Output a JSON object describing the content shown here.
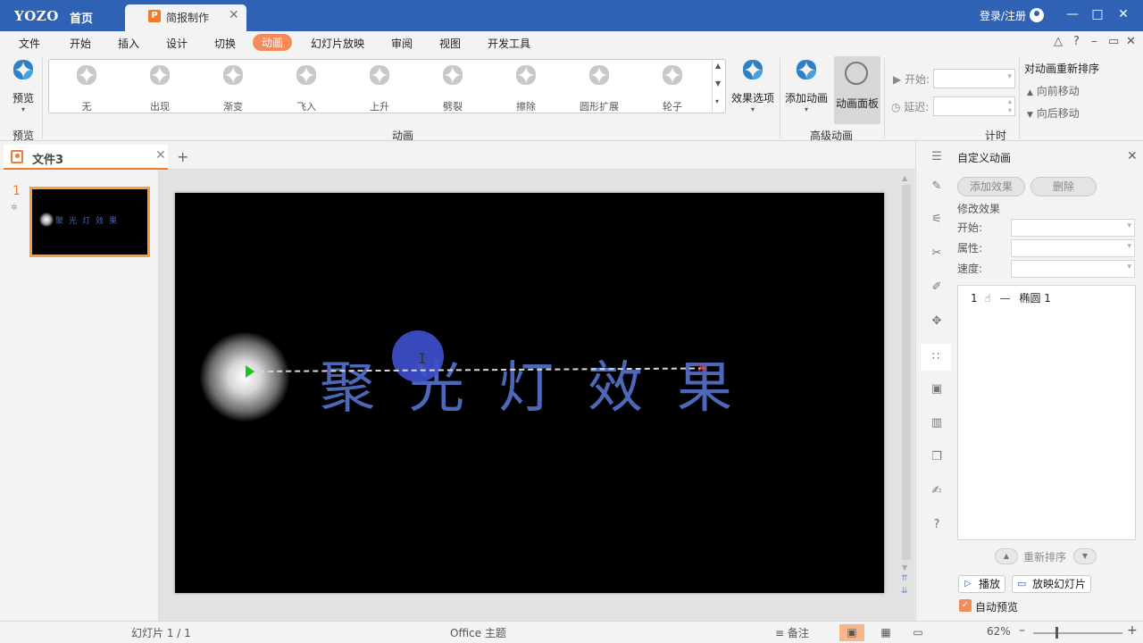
{
  "titlebar": {
    "logo": "YOZO",
    "home": "首页",
    "doc_tab": "简报制作",
    "login": "登录/注册",
    "minimize": "—",
    "maximize": "□",
    "close": "✕"
  },
  "menu": {
    "items": [
      "文件",
      "开始",
      "插入",
      "设计",
      "切换",
      "动画",
      "幻灯片放映",
      "审阅",
      "视图",
      "开发工具"
    ],
    "active": "动画"
  },
  "ribbon": {
    "preview_label": "预览",
    "preview_group": "预览",
    "gallery_items": [
      "无",
      "出现",
      "渐变",
      "飞入",
      "上升",
      "劈裂",
      "擦除",
      "圆形扩展",
      "轮子"
    ],
    "gallery_group": "动画",
    "effect_options": "效果选项",
    "add_animation": "添加动画",
    "animation_pane": "动画面板",
    "advanced_group": "高级动画",
    "start_label": "开始:",
    "delay_label": "延迟:",
    "timing_group": "计时",
    "reorder_title": "对动画重新排序",
    "move_earlier": "向前移动",
    "move_later": "向后移动"
  },
  "document": {
    "file_tab": "文件3",
    "slide_number": "1",
    "slide_title": "聚光灯效果"
  },
  "custom_animation": {
    "title": "自定义动画",
    "add_effect": "添加效果",
    "delete": "删除",
    "modify_label": "修改效果",
    "start_label": "开始:",
    "property_label": "属性:",
    "speed_label": "速度:",
    "list_item_index": "1",
    "list_item_name": "椭圆 1",
    "reorder_label": "重新排序",
    "play_button": "播放",
    "slideshow_button": "放映幻灯片",
    "auto_preview": "自动预览"
  },
  "statusbar": {
    "slide_info": "幻灯片 1 / 1",
    "theme": "Office 主题",
    "notes": "备注",
    "zoom": "62%"
  },
  "colors": {
    "title_bar": "#2f62b5",
    "accent": "#f58a5b",
    "slide_text": "#4d68b8",
    "ellipse": "#3e4fcc"
  }
}
